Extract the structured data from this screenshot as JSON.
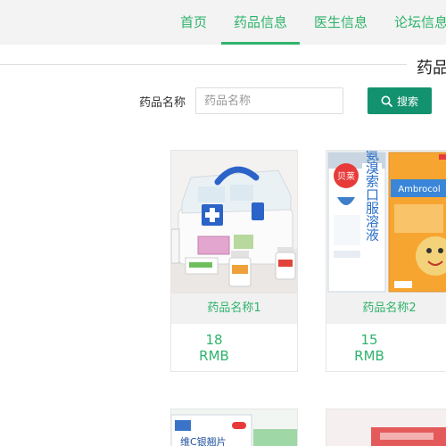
{
  "nav": {
    "items": [
      {
        "label": "首页"
      },
      {
        "label": "药品信息"
      },
      {
        "label": "医生信息"
      },
      {
        "label": "论坛信息"
      }
    ],
    "active_color": "#2fb36b"
  },
  "section": {
    "title": "药品"
  },
  "search": {
    "label": "药品名称",
    "placeholder": "药品名称",
    "value": "",
    "button_label": "搜索",
    "button_color": "#13926f"
  },
  "products": [
    {
      "name": "药品名称1",
      "price": "18",
      "currency": "RMB",
      "image": "first-aid-kit"
    },
    {
      "name": "药品名称2",
      "price": "15",
      "currency": "RMB",
      "image": "ambroxol-medicine-box"
    },
    {
      "name": "",
      "price": "",
      "currency": "",
      "image": "vitamin-c-box"
    },
    {
      "name": "",
      "price": "",
      "currency": "",
      "image": "red-medicine-box"
    }
  ],
  "product_images": {
    "card2_box_left_text": "盐酸氨溴索口服溶液",
    "card2_brand_left": "贝莱",
    "card2_brand_right": "Ambrocol",
    "card3_box_text": "维C银翘片"
  }
}
